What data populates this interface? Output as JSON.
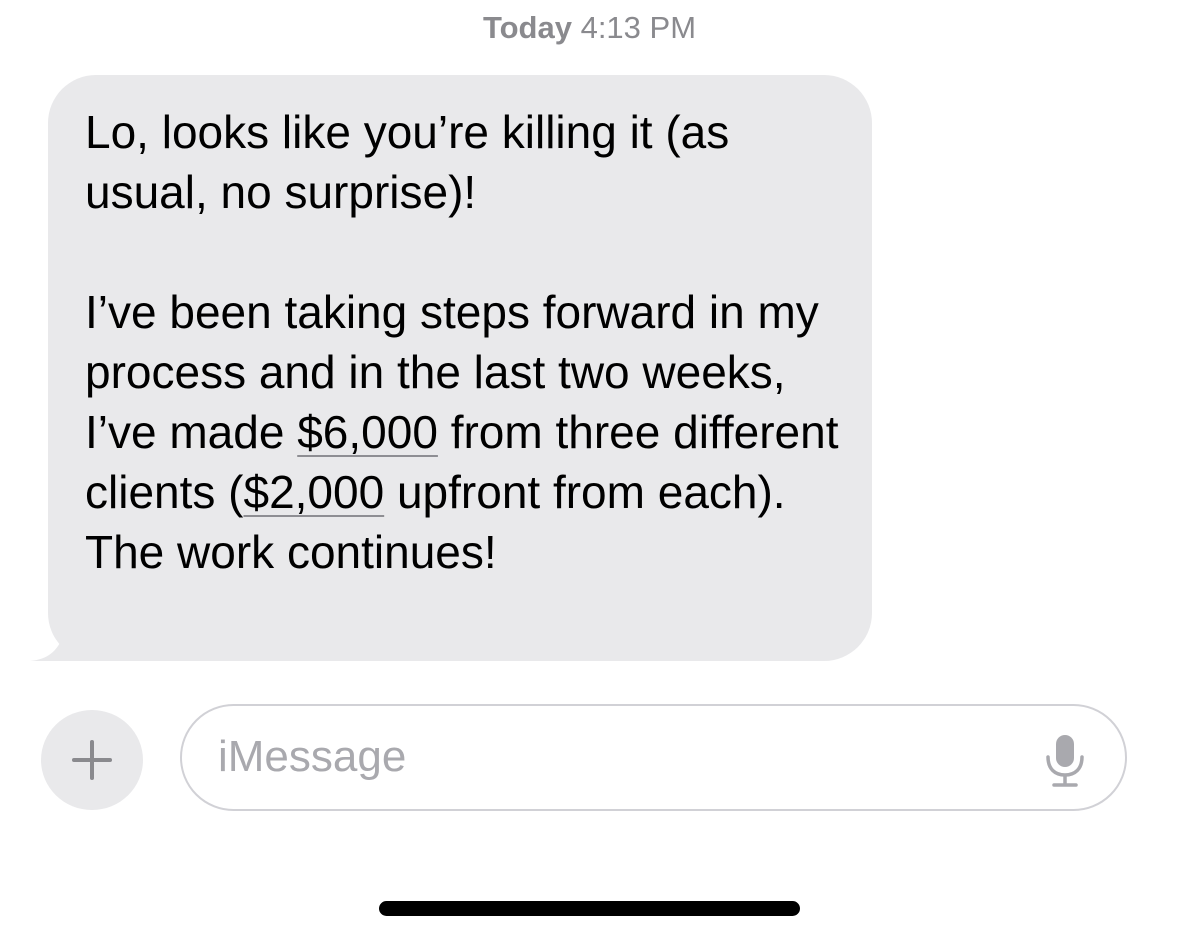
{
  "header": {
    "day": "Today",
    "time": "4:13 PM"
  },
  "message": {
    "paragraph1": "Lo, looks like you’re killing it (as usual, no surprise)!",
    "p2_part1": "I’ve been taking steps forward in my process and in the last two weeks, I’ve made ",
    "p2_amount1": "$6,000",
    "p2_part2": " from three different clients (",
    "p2_amount2": "$2,000",
    "p2_part3": " upfront from each). The work continues!"
  },
  "input_bar": {
    "placeholder": "iMessage",
    "value": "",
    "add_icon": "plus-icon",
    "mic_icon": "microphone-icon"
  },
  "colors": {
    "bubble_incoming": "#e9e9eb",
    "timestamp": "#8a8a8e",
    "placeholder": "#a9a9ae",
    "border": "#d1d1d6"
  }
}
